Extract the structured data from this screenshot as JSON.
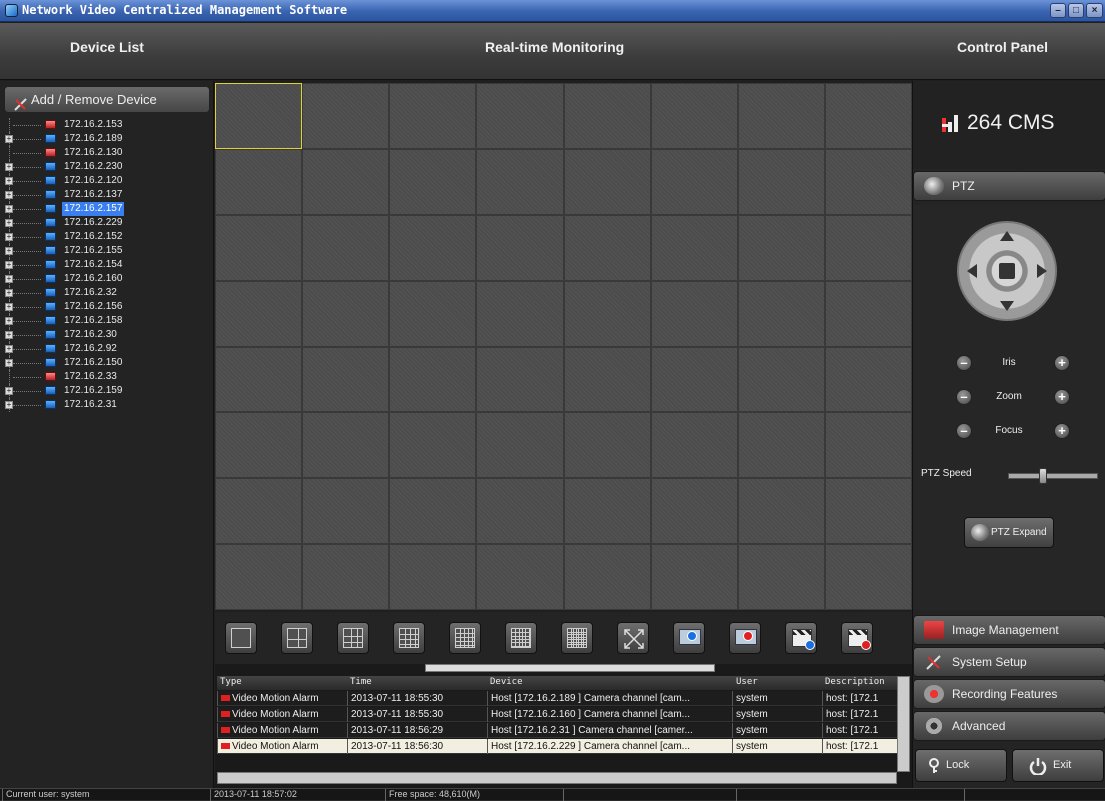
{
  "window": {
    "title": "Network Video Centralized Management Software"
  },
  "header": {
    "device_list": "Device List",
    "monitoring": "Real-time Monitoring",
    "control_panel": "Control Panel"
  },
  "device_panel": {
    "add_remove_label": "Add / Remove Device",
    "devices": [
      {
        "ip": "172.16.2.153",
        "expandable": false,
        "online": false,
        "selected": false
      },
      {
        "ip": "172.16.2.189",
        "expandable": true,
        "online": true,
        "selected": false
      },
      {
        "ip": "172.16.2.130",
        "expandable": false,
        "online": false,
        "selected": false
      },
      {
        "ip": "172.16.2.230",
        "expandable": true,
        "online": true,
        "selected": false
      },
      {
        "ip": "172.16.2.120",
        "expandable": true,
        "online": true,
        "selected": false
      },
      {
        "ip": "172.16.2.137",
        "expandable": true,
        "online": true,
        "selected": false
      },
      {
        "ip": "172.16.2.157",
        "expandable": true,
        "online": true,
        "selected": true
      },
      {
        "ip": "172.16.2.229",
        "expandable": true,
        "online": true,
        "selected": false
      },
      {
        "ip": "172.16.2.152",
        "expandable": true,
        "online": true,
        "selected": false
      },
      {
        "ip": "172.16.2.155",
        "expandable": true,
        "online": true,
        "selected": false
      },
      {
        "ip": "172.16.2.154",
        "expandable": true,
        "online": true,
        "selected": false
      },
      {
        "ip": "172.16.2.160",
        "expandable": true,
        "online": true,
        "selected": false
      },
      {
        "ip": "172.16.2.32",
        "expandable": true,
        "online": true,
        "selected": false
      },
      {
        "ip": "172.16.2.156",
        "expandable": true,
        "online": true,
        "selected": false
      },
      {
        "ip": "172.16.2.158",
        "expandable": true,
        "online": true,
        "selected": false
      },
      {
        "ip": "172.16.2.30",
        "expandable": true,
        "online": true,
        "selected": false
      },
      {
        "ip": "172.16.2.92",
        "expandable": true,
        "online": true,
        "selected": false
      },
      {
        "ip": "172.16.2.150",
        "expandable": true,
        "online": true,
        "selected": false
      },
      {
        "ip": "172.16.2.33",
        "expandable": false,
        "online": false,
        "selected": false
      },
      {
        "ip": "172.16.2.159",
        "expandable": true,
        "online": true,
        "selected": false
      },
      {
        "ip": "172.16.2.31",
        "expandable": true,
        "online": true,
        "selected": false
      }
    ]
  },
  "monitor": {
    "layout": "8x8",
    "active_cell": 0
  },
  "toolbar": {
    "buttons": [
      {
        "name": "layout-1-button",
        "icon": "layout-1-icon"
      },
      {
        "name": "layout-4-button",
        "icon": "layout-4-icon"
      },
      {
        "name": "layout-9-button",
        "icon": "layout-9-icon"
      },
      {
        "name": "layout-16-button",
        "icon": "layout-16-icon"
      },
      {
        "name": "layout-25-button",
        "icon": "layout-25-icon"
      },
      {
        "name": "layout-36-button",
        "icon": "layout-36-icon"
      },
      {
        "name": "layout-64-button",
        "icon": "layout-64-icon"
      },
      {
        "name": "fullscreen-button",
        "icon": "fullscreen-icon"
      },
      {
        "name": "start-all-preview-button",
        "icon": "monitor-play-icon"
      },
      {
        "name": "stop-all-preview-button",
        "icon": "monitor-stop-icon"
      },
      {
        "name": "start-all-record-button",
        "icon": "clapper-play-icon"
      },
      {
        "name": "stop-all-record-button",
        "icon": "clapper-stop-icon"
      }
    ]
  },
  "log": {
    "columns": [
      "Type",
      "Time",
      "Device",
      "User",
      "Description"
    ],
    "rows": [
      {
        "type": "Video Motion Alarm",
        "time": "2013-07-11 18:55:30",
        "device": "Host [172.16.2.189 ] Camera channel [cam...",
        "user": "system",
        "desc": "host: [172.1",
        "highlight": false
      },
      {
        "type": "Video Motion Alarm",
        "time": "2013-07-11 18:55:30",
        "device": "Host [172.16.2.160 ] Camera channel [cam...",
        "user": "system",
        "desc": "host: [172.1",
        "highlight": false
      },
      {
        "type": "Video Motion Alarm",
        "time": "2013-07-11 18:56:29",
        "device": "Host [172.16.2.31 ] Camera channel [camer...",
        "user": "system",
        "desc": "host: [172.1",
        "highlight": false
      },
      {
        "type": "Video Motion Alarm",
        "time": "2013-07-11 18:56:30",
        "device": "Host [172.16.2.229 ] Camera channel [cam...",
        "user": "system",
        "desc": "host: [172.1",
        "highlight": true
      }
    ]
  },
  "control": {
    "logo_text": "264 CMS",
    "ptz_label": "PTZ",
    "iris_label": "Iris",
    "zoom_label": "Zoom",
    "focus_label": "Focus",
    "speed_label": "PTZ Speed",
    "speed_level": 0.35,
    "ptz_expand_label": "PTZ Expand",
    "image_mgmt_label": "Image Management",
    "system_setup_label": "System Setup",
    "recording_label": "Recording Features",
    "advanced_label": "Advanced",
    "lock_label": "Lock",
    "exit_label": "Exit"
  },
  "status": {
    "user": "Current user: system",
    "time": "2013-07-11 18:57:02",
    "free_space": "Free space: 48,610(M)"
  }
}
